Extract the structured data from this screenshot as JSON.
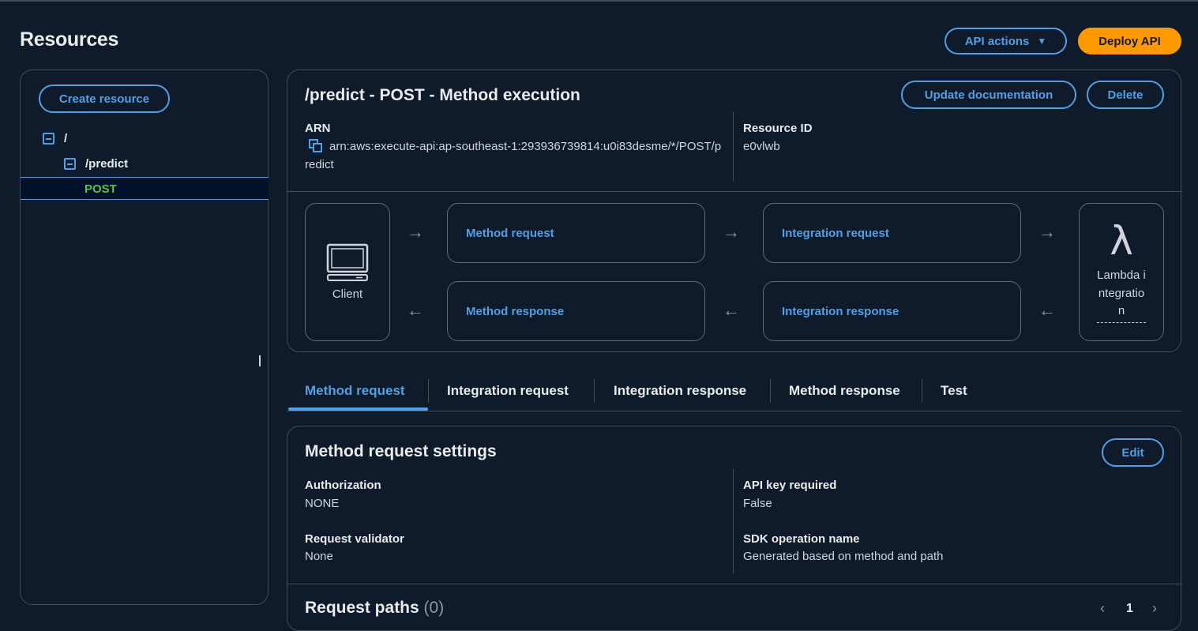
{
  "header": {
    "title": "Resources",
    "api_actions_label": "API actions",
    "deploy_label": "Deploy API"
  },
  "sidebar": {
    "create_label": "Create resource",
    "tree": [
      {
        "label": "/"
      },
      {
        "label": "/predict"
      },
      {
        "label": "POST"
      }
    ]
  },
  "execution": {
    "title": "/predict - POST - Method execution",
    "update_doc_label": "Update documentation",
    "delete_label": "Delete",
    "arn_label": "ARN",
    "arn_value": "arn:aws:execute-api:ap-southeast-1:293936739814:u0i83desme/*/POST/predict",
    "resource_id_label": "Resource ID",
    "resource_id_value": "e0vlwb",
    "client_label": "Client",
    "method_request": "Method request",
    "integration_request": "Integration request",
    "method_response": "Method response",
    "integration_response": "Integration response",
    "lambda_glyph": "λ",
    "lambda_label": "Lambda integration"
  },
  "tabs": [
    {
      "label": "Method request"
    },
    {
      "label": "Integration request"
    },
    {
      "label": "Integration response"
    },
    {
      "label": "Method response"
    },
    {
      "label": "Test"
    }
  ],
  "settings": {
    "title": "Method request settings",
    "edit_label": "Edit",
    "authorization_label": "Authorization",
    "authorization_value": "NONE",
    "api_key_label": "API key required",
    "api_key_value": "False",
    "validator_label": "Request validator",
    "validator_value": "None",
    "sdk_label": "SDK operation name",
    "sdk_value": "Generated based on method and path",
    "paths_title": "Request paths",
    "paths_count": "(0)",
    "page_number": "1"
  },
  "colors": {
    "background": "#0f1b2a",
    "accent": "#539fe5",
    "primary": "#ff9900",
    "method_green": "#5fbf4d"
  }
}
